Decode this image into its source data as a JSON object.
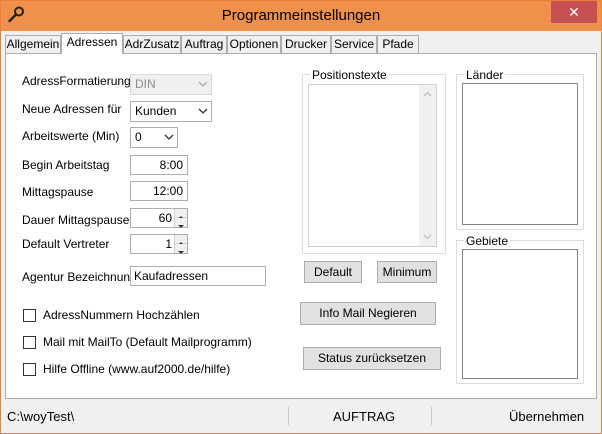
{
  "window": {
    "title": "Programmeinstellungen",
    "close_label": "✕",
    "app_icon": "wrench-icon"
  },
  "tabs": [
    {
      "label": "Allgemein",
      "active": false
    },
    {
      "label": "Adressen",
      "active": true
    },
    {
      "label": "AdrZusatz",
      "active": false
    },
    {
      "label": "Auftrag",
      "active": false
    },
    {
      "label": "Optionen",
      "active": false
    },
    {
      "label": "Drucker",
      "active": false
    },
    {
      "label": "Service",
      "active": false
    },
    {
      "label": "Pfade",
      "active": false
    }
  ],
  "form": {
    "adressformatierung": {
      "label": "AdressFormatierung",
      "value": "DIN",
      "disabled": true
    },
    "neue_adressen": {
      "label": "Neue Adressen für",
      "value": "Kunden"
    },
    "arbeitswerte": {
      "label": "Arbeitswerte (Min)",
      "value": "0"
    },
    "begin_arbeitstag": {
      "label": "Begin Arbeitstag",
      "value": "8:00"
    },
    "mittagspause": {
      "label": "Mittagspause",
      "value": "12:00"
    },
    "dauer_mittagspause": {
      "label": "Dauer Mittagspause",
      "value": "60"
    },
    "default_vertreter": {
      "label": "Default Vertreter",
      "value": "1"
    },
    "agentur_bezeichnung": {
      "label": "Agentur Bezeichnung",
      "value": "Kaufadressen"
    }
  },
  "checkboxes": [
    {
      "label": "AdressNummern Hochzählen",
      "checked": false
    },
    {
      "label": "Mail mit  MailTo (Default Mailprogramm)",
      "checked": false
    },
    {
      "label": "Hilfe Offline (www.auf2000.de/hilfe)",
      "checked": false
    }
  ],
  "positionstexte": {
    "title": "Positionstexte",
    "default_button": "Default",
    "minimum_button": "Minimum"
  },
  "buttons": {
    "info_mail": "Info Mail Negieren",
    "status_reset": "Status zurücksetzen"
  },
  "laender": {
    "title": "Länder"
  },
  "gebiete": {
    "title": "Gebiete"
  },
  "statusbar": {
    "path": "C:\\woyTest\\",
    "mode": "AUFTRAG",
    "action": "Übernehmen"
  }
}
